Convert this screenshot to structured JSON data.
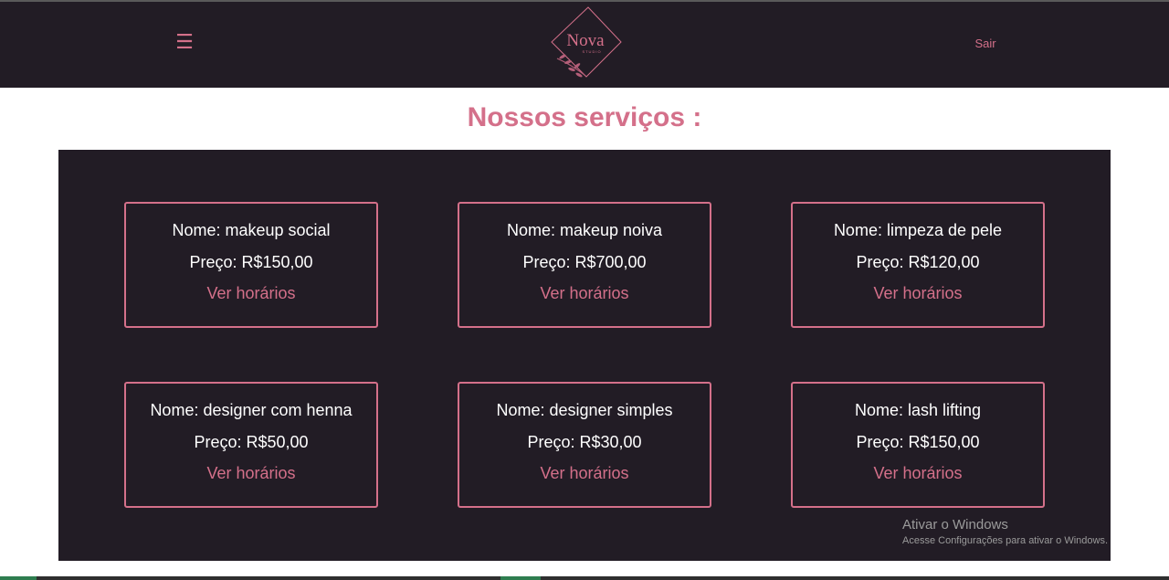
{
  "header": {
    "menu_icon": "hamburger-menu-icon",
    "logo_text": "Nova",
    "logo_subtext": "STUDIO",
    "logout_label": "Sair",
    "background": "#221c25",
    "accent": "#d4708a"
  },
  "main": {
    "title": "Nossos serviços :",
    "services": [
      {
        "name": "Nome: makeup social",
        "price": "Preço: R$150,00",
        "link": "Ver horários"
      },
      {
        "name": "Nome: makeup noiva",
        "price": "Preço: R$700,00",
        "link": "Ver horários"
      },
      {
        "name": "Nome: limpeza de pele",
        "price": "Preço: R$120,00",
        "link": "Ver horários"
      },
      {
        "name": "Nome: designer com henna",
        "price": "Preço: R$50,00",
        "link": "Ver horários"
      },
      {
        "name": "Nome: designer simples",
        "price": "Preço: R$30,00",
        "link": "Ver horários"
      },
      {
        "name": "Nome: lash lifting",
        "price": "Preço: R$150,00",
        "link": "Ver horários"
      }
    ]
  },
  "watermark": {
    "line1": "Ativar o Windows",
    "line2": "Acesse Configurações para ativar o Windows."
  }
}
